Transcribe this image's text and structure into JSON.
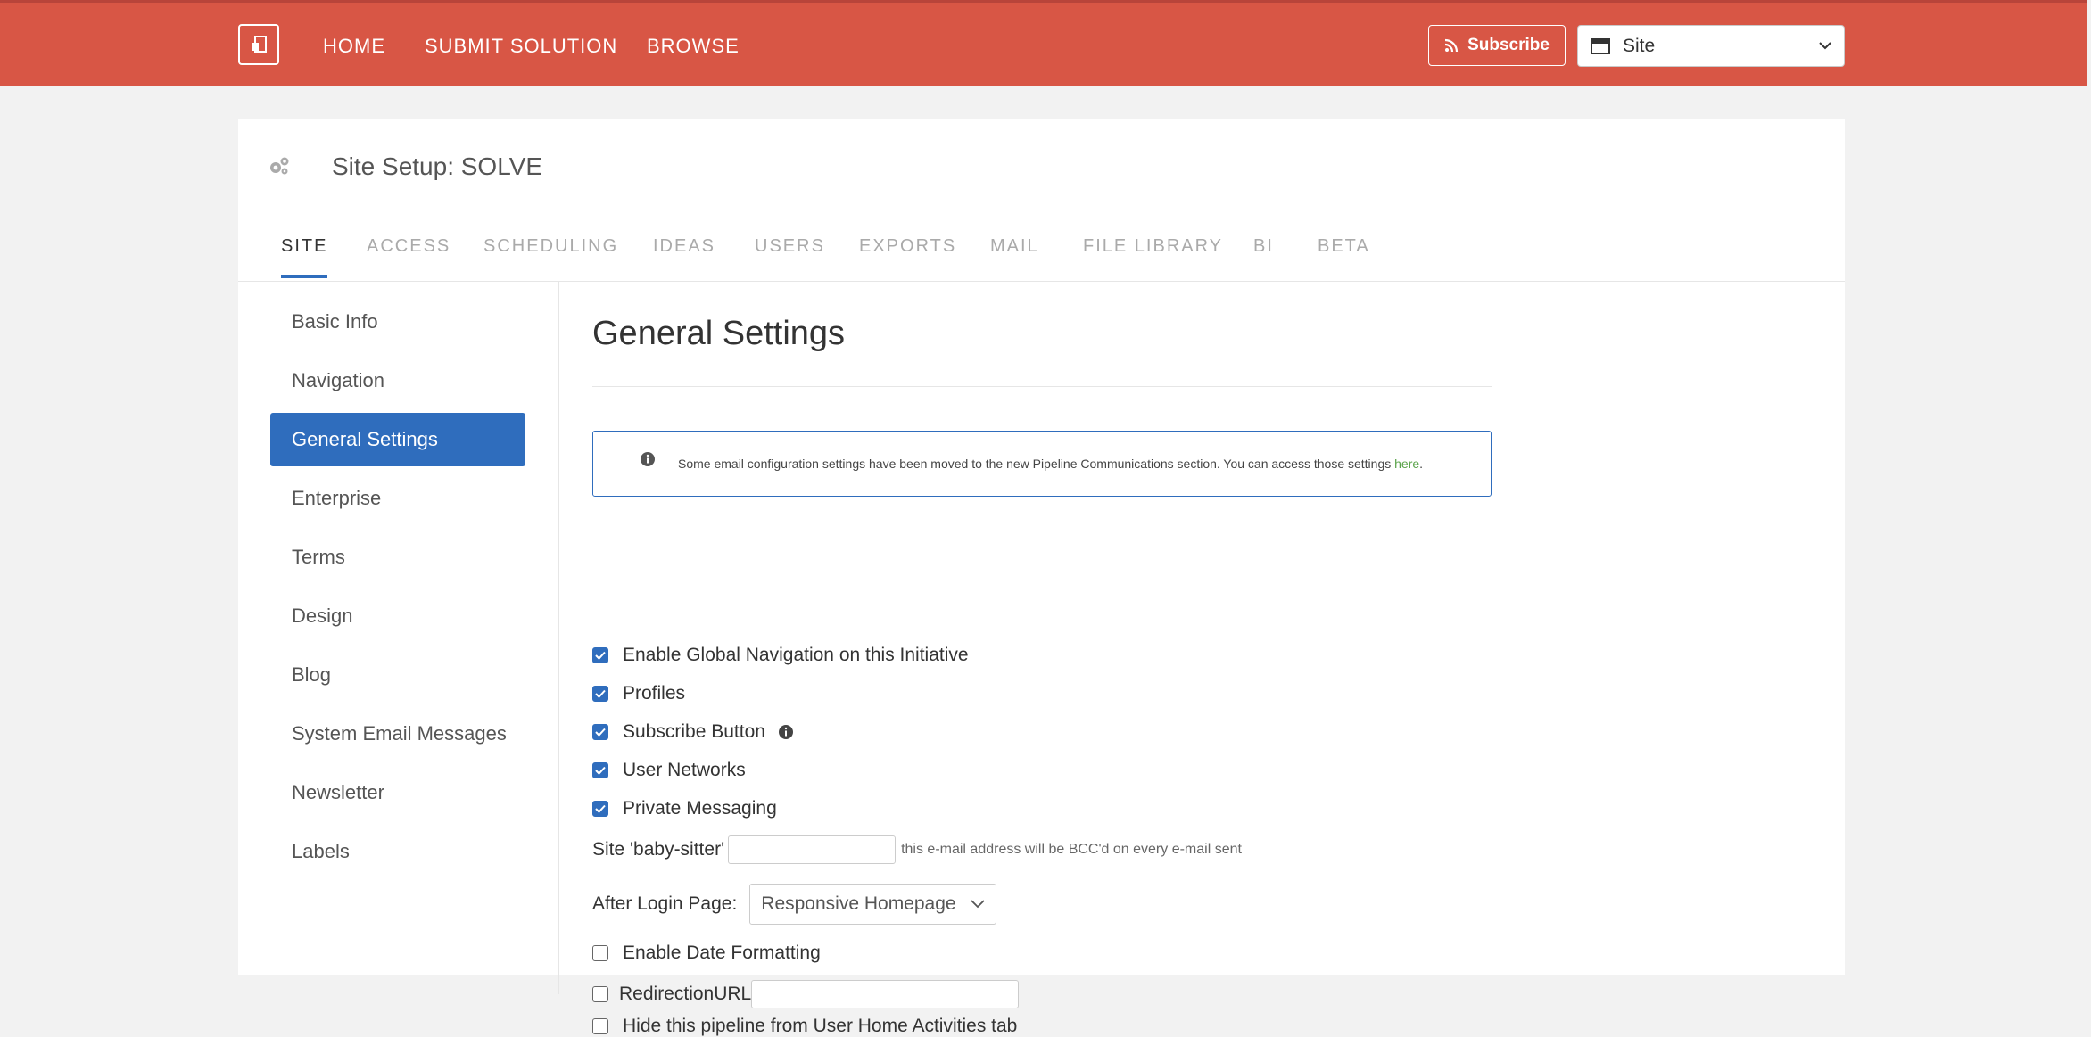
{
  "topbar": {
    "nav": [
      "HOME",
      "SUBMIT SOLUTION",
      "BROWSE"
    ],
    "subscribe_label": "Subscribe",
    "site_select_value": "Site"
  },
  "page": {
    "title": "Site Setup: SOLVE"
  },
  "tabs": [
    "SITE",
    "ACCESS",
    "SCHEDULING",
    "IDEAS",
    "USERS",
    "EXPORTS",
    "MAIL",
    "FILE LIBRARY",
    "BI",
    "BETA"
  ],
  "sidebar": {
    "items": [
      "Basic Info",
      "Navigation",
      "General Settings",
      "Enterprise",
      "Terms",
      "Design",
      "Blog",
      "System Email Messages",
      "Newsletter",
      "Labels"
    ]
  },
  "main": {
    "title": "General Settings",
    "alert_text": "Some email configuration settings have been moved to the new Pipeline Communications section. You can access those settings ",
    "alert_link": "here",
    "alert_end": ".",
    "checkboxes_top": [
      {
        "label": "Enable Global Navigation on this Initiative",
        "checked": true
      },
      {
        "label": "Profiles",
        "checked": true
      },
      {
        "label": "Subscribe Button",
        "checked": true
      },
      {
        "label": "User Networks",
        "checked": true
      },
      {
        "label": "Private Messaging",
        "checked": true
      }
    ],
    "babysitter_label": "Site 'baby-sitter'",
    "babysitter_value": "",
    "babysitter_hint": "this e-mail address will be BCC'd on every e-mail sent",
    "after_login_label": "After Login Page:",
    "after_login_value": "Responsive Homepage",
    "date_formatting_label": "Enable Date Formatting",
    "redirection_label": "RedirectionURL",
    "redirection_value": "",
    "hide_pipeline_label": "Hide this pipeline from User Home Activities tab"
  },
  "colors": {
    "brand": "#d85645",
    "accent": "#2f6dbd",
    "link": "#5aa34a"
  }
}
